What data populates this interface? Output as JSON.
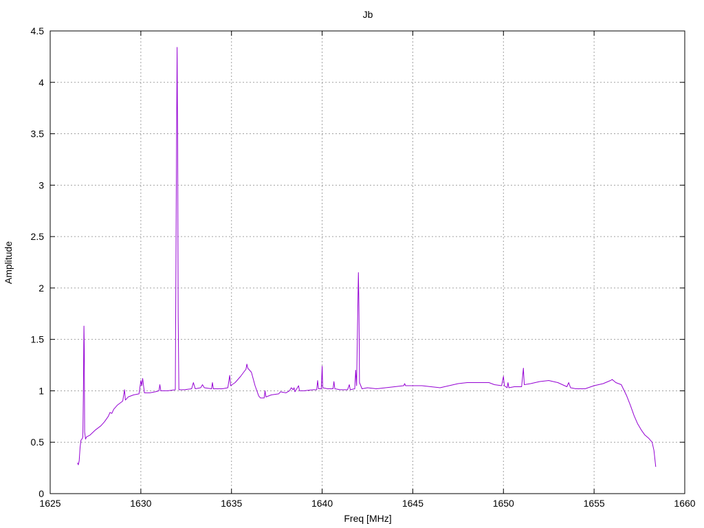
{
  "chart_data": {
    "type": "line",
    "title": "Jb",
    "xlabel": "Freq [MHz]",
    "ylabel": "Amplitude",
    "xlim": [
      1625,
      1660
    ],
    "ylim": [
      0,
      4.5
    ],
    "xticks": [
      1625,
      1630,
      1635,
      1640,
      1645,
      1650,
      1655,
      1660
    ],
    "yticks": [
      0,
      0.5,
      1,
      1.5,
      2,
      2.5,
      3,
      3.5,
      4,
      4.5
    ],
    "grid": true,
    "line_color": "#9400d3",
    "series": [
      {
        "points": [
          [
            1626.5,
            0.3
          ],
          [
            1626.55,
            0.28
          ],
          [
            1626.6,
            0.32
          ],
          [
            1626.65,
            0.45
          ],
          [
            1626.7,
            0.52
          ],
          [
            1626.75,
            0.53
          ],
          [
            1626.8,
            0.55
          ],
          [
            1626.83,
            1.0
          ],
          [
            1626.86,
            1.63
          ],
          [
            1626.88,
            1.4
          ],
          [
            1626.9,
            0.6
          ],
          [
            1626.95,
            0.53
          ],
          [
            1627.0,
            0.55
          ],
          [
            1627.2,
            0.57
          ],
          [
            1627.5,
            0.62
          ],
          [
            1627.8,
            0.66
          ],
          [
            1628.0,
            0.7
          ],
          [
            1628.2,
            0.75
          ],
          [
            1628.3,
            0.79
          ],
          [
            1628.4,
            0.78
          ],
          [
            1628.5,
            0.82
          ],
          [
            1628.7,
            0.86
          ],
          [
            1629.0,
            0.9
          ],
          [
            1629.1,
            1.01
          ],
          [
            1629.15,
            0.91
          ],
          [
            1629.3,
            0.94
          ],
          [
            1629.6,
            0.96
          ],
          [
            1629.9,
            0.97
          ],
          [
            1630.0,
            1.1
          ],
          [
            1630.05,
            1.05
          ],
          [
            1630.1,
            1.12
          ],
          [
            1630.2,
            0.98
          ],
          [
            1630.5,
            0.98
          ],
          [
            1630.8,
            0.99
          ],
          [
            1631.0,
            1.0
          ],
          [
            1631.05,
            1.06
          ],
          [
            1631.1,
            1.0
          ],
          [
            1631.5,
            1.0
          ],
          [
            1631.9,
            1.01
          ],
          [
            1631.97,
            3.4
          ],
          [
            1632.0,
            4.34
          ],
          [
            1632.03,
            3.39
          ],
          [
            1632.06,
            1.72
          ],
          [
            1632.1,
            1.01
          ],
          [
            1632.4,
            1.01
          ],
          [
            1632.8,
            1.02
          ],
          [
            1632.9,
            1.08
          ],
          [
            1633.0,
            1.02
          ],
          [
            1633.3,
            1.03
          ],
          [
            1633.4,
            1.06
          ],
          [
            1633.5,
            1.03
          ],
          [
            1633.9,
            1.02
          ],
          [
            1633.95,
            1.08
          ],
          [
            1634.0,
            1.02
          ],
          [
            1634.5,
            1.02
          ],
          [
            1634.8,
            1.03
          ],
          [
            1634.9,
            1.15
          ],
          [
            1634.95,
            1.05
          ],
          [
            1635.2,
            1.08
          ],
          [
            1635.5,
            1.14
          ],
          [
            1635.8,
            1.21
          ],
          [
            1635.85,
            1.26
          ],
          [
            1635.9,
            1.22
          ],
          [
            1636.1,
            1.18
          ],
          [
            1636.3,
            1.05
          ],
          [
            1636.5,
            0.95
          ],
          [
            1636.6,
            0.93
          ],
          [
            1636.8,
            0.93
          ],
          [
            1636.85,
            1.0
          ],
          [
            1636.9,
            0.94
          ],
          [
            1637.2,
            0.96
          ],
          [
            1637.6,
            0.97
          ],
          [
            1637.7,
            0.99
          ],
          [
            1638.0,
            0.98
          ],
          [
            1638.2,
            1.0
          ],
          [
            1638.3,
            1.03
          ],
          [
            1638.4,
            1.01
          ],
          [
            1638.45,
            1.03
          ],
          [
            1638.5,
            0.99
          ],
          [
            1638.7,
            1.05
          ],
          [
            1638.75,
            1.0
          ],
          [
            1639.0,
            1.0
          ],
          [
            1639.5,
            1.01
          ],
          [
            1639.7,
            1.01
          ],
          [
            1639.75,
            1.1
          ],
          [
            1639.8,
            1.02
          ],
          [
            1639.95,
            1.02
          ],
          [
            1640.0,
            1.24
          ],
          [
            1640.03,
            1.03
          ],
          [
            1640.3,
            1.02
          ],
          [
            1640.6,
            1.02
          ],
          [
            1640.65,
            1.09
          ],
          [
            1640.7,
            1.02
          ],
          [
            1641.0,
            1.01
          ],
          [
            1641.4,
            1.01
          ],
          [
            1641.5,
            1.06
          ],
          [
            1641.55,
            1.01
          ],
          [
            1641.8,
            1.02
          ],
          [
            1641.85,
            1.2
          ],
          [
            1641.9,
            1.05
          ],
          [
            1641.95,
            1.62
          ],
          [
            1642.0,
            2.15
          ],
          [
            1642.03,
            1.82
          ],
          [
            1642.06,
            1.08
          ],
          [
            1642.2,
            1.02
          ],
          [
            1642.5,
            1.03
          ],
          [
            1643.0,
            1.02
          ],
          [
            1643.5,
            1.03
          ],
          [
            1644.0,
            1.04
          ],
          [
            1644.5,
            1.05
          ],
          [
            1644.55,
            1.07
          ],
          [
            1644.6,
            1.05
          ],
          [
            1645.0,
            1.05
          ],
          [
            1645.5,
            1.05
          ],
          [
            1646.0,
            1.04
          ],
          [
            1646.5,
            1.03
          ],
          [
            1647.0,
            1.05
          ],
          [
            1647.5,
            1.07
          ],
          [
            1648.0,
            1.08
          ],
          [
            1648.5,
            1.08
          ],
          [
            1649.0,
            1.08
          ],
          [
            1649.2,
            1.08
          ],
          [
            1649.5,
            1.06
          ],
          [
            1649.9,
            1.05
          ],
          [
            1650.0,
            1.14
          ],
          [
            1650.05,
            1.05
          ],
          [
            1650.2,
            1.03
          ],
          [
            1650.25,
            1.08
          ],
          [
            1650.3,
            1.03
          ],
          [
            1650.6,
            1.04
          ],
          [
            1651.0,
            1.04
          ],
          [
            1651.1,
            1.22
          ],
          [
            1651.15,
            1.06
          ],
          [
            1651.5,
            1.07
          ],
          [
            1652.0,
            1.09
          ],
          [
            1652.5,
            1.1
          ],
          [
            1653.0,
            1.08
          ],
          [
            1653.5,
            1.04
          ],
          [
            1653.6,
            1.08
          ],
          [
            1653.7,
            1.03
          ],
          [
            1654.0,
            1.02
          ],
          [
            1654.5,
            1.02
          ],
          [
            1655.0,
            1.05
          ],
          [
            1655.5,
            1.07
          ],
          [
            1655.9,
            1.1
          ],
          [
            1656.0,
            1.11
          ],
          [
            1656.2,
            1.08
          ],
          [
            1656.5,
            1.06
          ],
          [
            1656.8,
            0.95
          ],
          [
            1657.0,
            0.86
          ],
          [
            1657.2,
            0.76
          ],
          [
            1657.4,
            0.68
          ],
          [
            1657.6,
            0.62
          ],
          [
            1657.8,
            0.57
          ],
          [
            1658.0,
            0.54
          ],
          [
            1658.2,
            0.5
          ],
          [
            1658.3,
            0.42
          ],
          [
            1658.4,
            0.26
          ]
        ]
      }
    ]
  }
}
